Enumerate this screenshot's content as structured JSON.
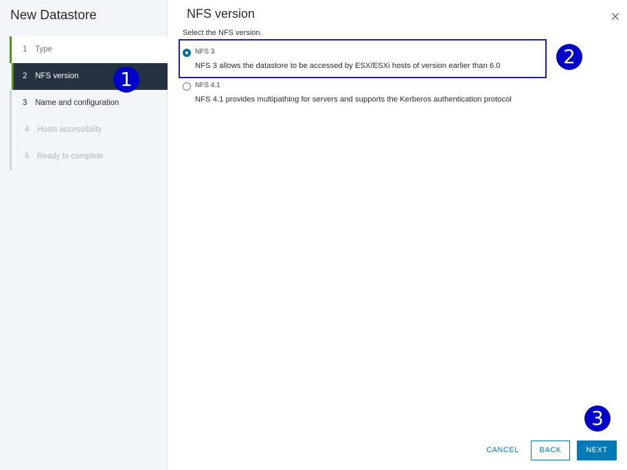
{
  "wizard": {
    "title": "New Datastore",
    "steps": [
      {
        "num": "1",
        "label": "Type"
      },
      {
        "num": "2",
        "label": "NFS version"
      },
      {
        "num": "3",
        "label": "Name and configuration"
      },
      {
        "num": "4",
        "label": "Hosts accessibility"
      },
      {
        "num": "5",
        "label": "Ready to complete"
      }
    ],
    "current_step": "2"
  },
  "page": {
    "title": "NFS version",
    "instruction": "Select the NFS version.",
    "options": [
      {
        "label": "NFS 3",
        "description": "NFS 3 allows the datastore to be accessed by ESX/ESXi hosts of version earlier than 6.0",
        "selected": true
      },
      {
        "label": "NFS 4.1",
        "description": "NFS 4.1 provides multipathing for servers and supports the Kerberos authentication protocol",
        "selected": false
      }
    ]
  },
  "footer": {
    "cancel_label": "CANCEL",
    "back_label": "BACK",
    "next_label": "NEXT"
  },
  "callouts": [
    "1",
    "2",
    "3"
  ],
  "colors": {
    "accent": "#0079b8",
    "current_step_bg": "#25323f",
    "step_done_bar": "#48960c",
    "callout": "#0000cc"
  },
  "icons": {
    "close": "close-icon"
  }
}
